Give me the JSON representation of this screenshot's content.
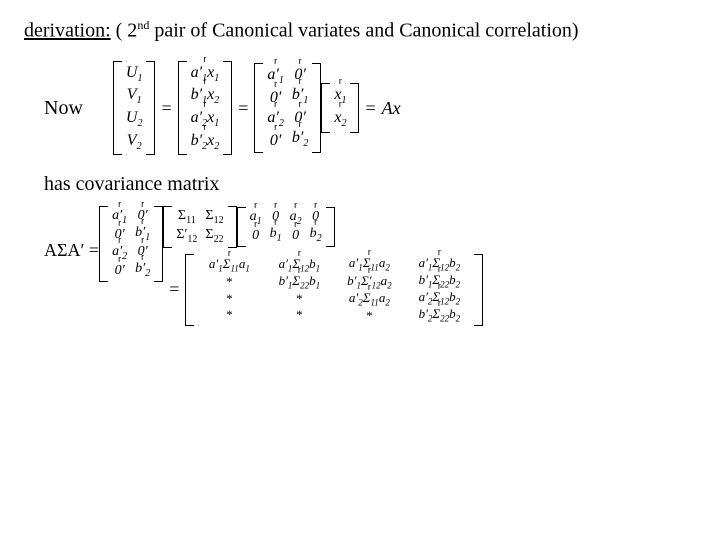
{
  "title": {
    "keyword": "derivation:",
    "rest": " ( 2",
    "sup": "nd",
    "rest2": " pair of Canonical variates and Canonical correlation)"
  },
  "now": "Now",
  "has_cov": "has covariance matrix",
  "eq": "=",
  "Ax": "Ax",
  "ASigAp": "AΣA′ =",
  "vec": {
    "U1": "U",
    "U1s": "1",
    "V1": "V",
    "V1s": "1",
    "U2": "U",
    "U2s": "2",
    "V2": "V",
    "V2s": "2"
  },
  "col_ax": {
    "r1": "a′",
    "r1s": "1",
    "r1x": "x",
    "r1xs": "1",
    "r2": "b′",
    "r2s": "1",
    "r2x": "x",
    "r2xs": "2",
    "r3": "a′",
    "r3s": "2",
    "r3x": "x",
    "r3xs": "1",
    "r4": "b′",
    "r4s": "2",
    "r4x": "x",
    "r4xs": "2"
  },
  "block": {
    "a1p": "a′",
    "a1s": "1",
    "b1p": "b′",
    "b1s": "1",
    "a2p": "a′",
    "a2s": "2",
    "b2p": "b′",
    "b2s": "2",
    "zp": "0′",
    "a1": "a",
    "b1": "b",
    "a2": "a",
    "b2": "b",
    "z": "0"
  },
  "x": {
    "x1": "x",
    "x1s": "1",
    "x2": "x",
    "x2s": "2"
  },
  "Sigma": {
    "s11": "Σ",
    "s11s": "11",
    "s12": "Σ",
    "s12s": "12",
    "s12p": "Σ′",
    "s12ps": "12",
    "s22": "Σ",
    "s22s": "22"
  },
  "big": {
    "c11": "a′",
    "c11a": "1",
    "c11S": "Σ",
    "c11Ss": "11",
    "c11b": "a",
    "c11bs": "1",
    "c12": "a′",
    "c12a": "1",
    "c12S": "Σ",
    "c12Ss": "12",
    "c12b": "b",
    "c12bs": "1",
    "c13": "a′",
    "c13a": "1",
    "c13S": "Σ",
    "c13Ss": "11",
    "c13b": "a",
    "c13bs": "2",
    "c14": "a′",
    "c14a": "1",
    "c14S": "Σ",
    "c14Ss": "12",
    "c14b": "b",
    "c14bs": "2",
    "c22": "b′",
    "c22a": "1",
    "c22S": "Σ",
    "c22Ss": "22",
    "c22b": "b",
    "c22bs": "1",
    "c23": "b′",
    "c23a": "1",
    "c23S": "Σ′",
    "c23Ss": "12",
    "c23b": "a",
    "c23bs": "2",
    "c24": "b′",
    "c24a": "1",
    "c24S": "Σ",
    "c24Ss": "22",
    "c24b": "b",
    "c24bs": "2",
    "c33": "a′",
    "c33a": "2",
    "c33S": "Σ",
    "c33Ss": "11",
    "c33b": "a",
    "c33bs": "2",
    "c34": "a′",
    "c34a": "2",
    "c34S": "Σ",
    "c34Ss": "12",
    "c34b": "b",
    "c34bs": "2",
    "c44": "b′",
    "c44a": "2",
    "c44S": "Σ",
    "c44Ss": "22",
    "c44b": "b",
    "c44bs": "2",
    "star": "*"
  }
}
